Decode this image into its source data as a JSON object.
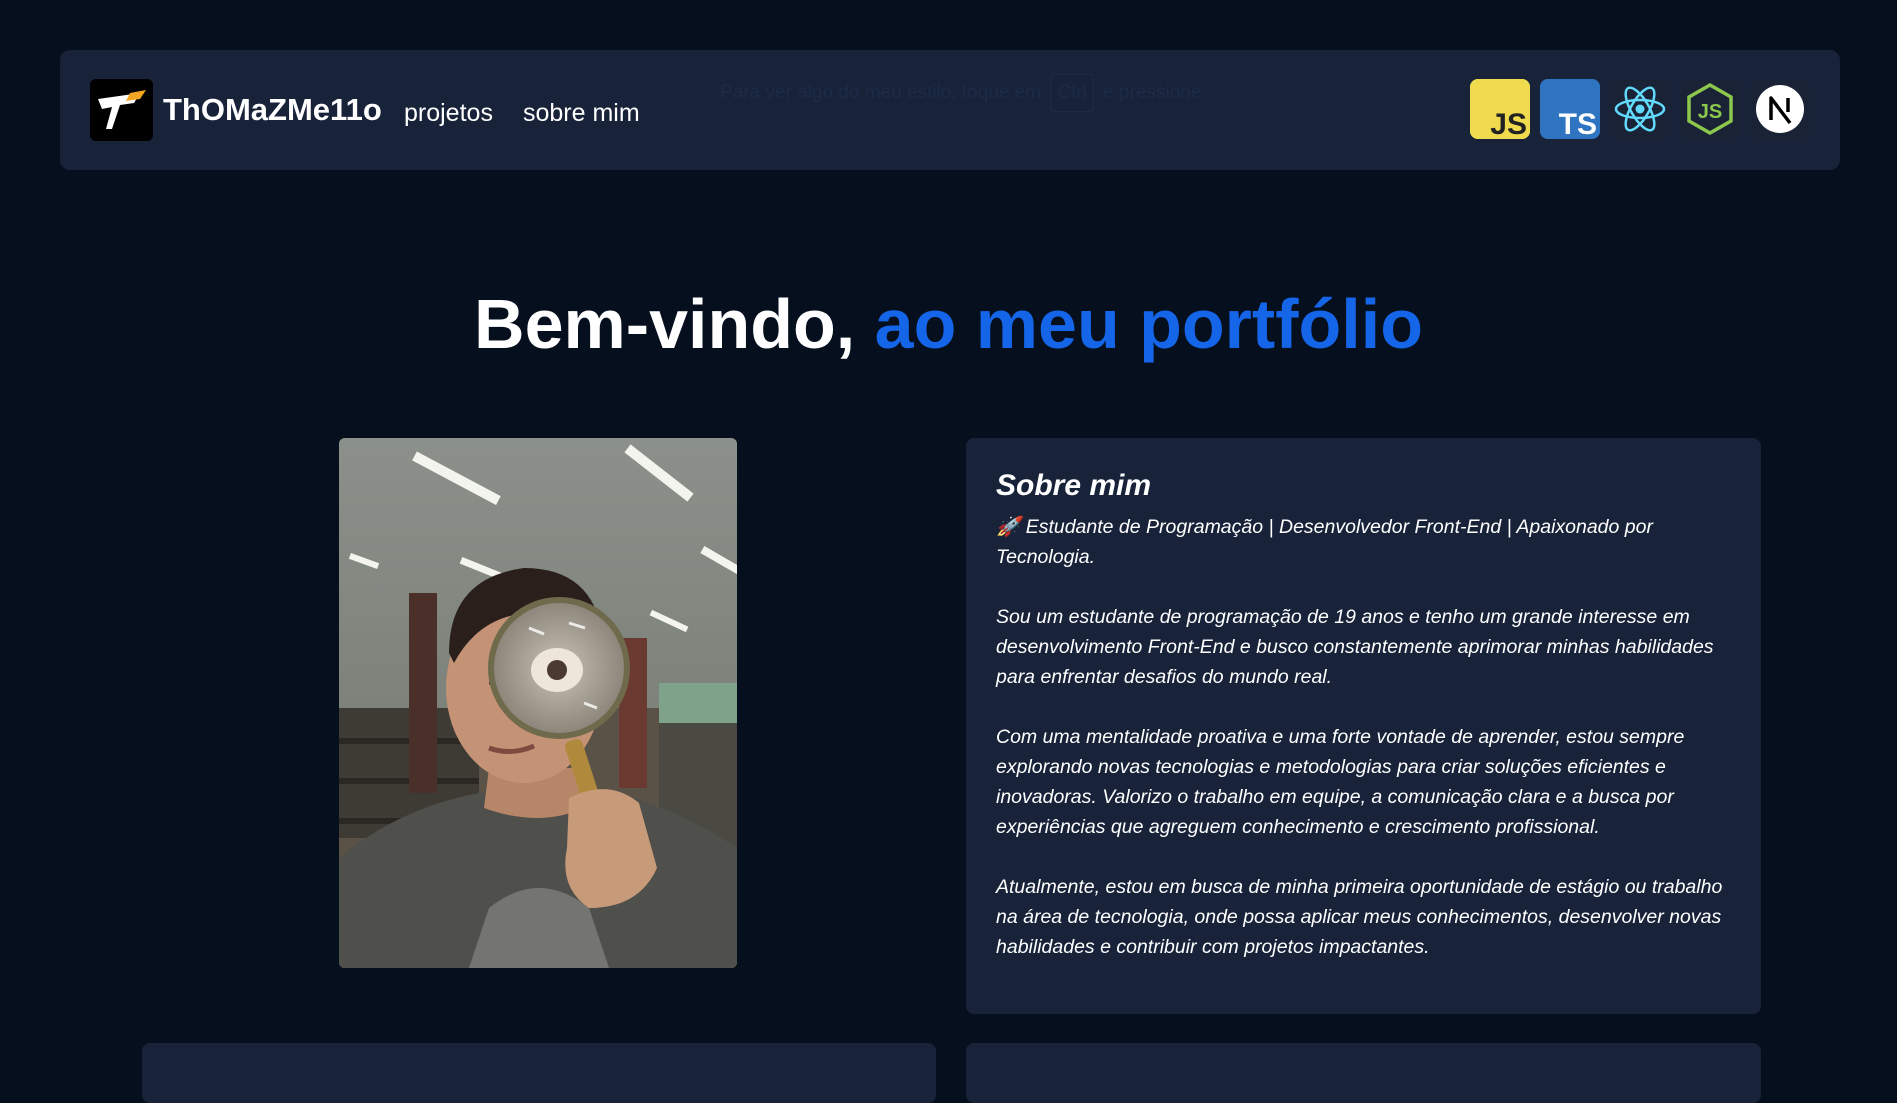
{
  "navbar": {
    "brand": "ThOMaZMe11o",
    "links": [
      "projetos",
      "sobre mim"
    ],
    "hint": {
      "before": "Para ver algo do meu estilo, toque em",
      "key": "Ctrl",
      "after": "e pressione"
    },
    "tech_icons": [
      {
        "name": "javascript-icon",
        "label": "JS",
        "color": "#f0db4f"
      },
      {
        "name": "typescript-icon",
        "label": "TS",
        "color": "#2f74c0"
      },
      {
        "name": "react-icon",
        "label": "",
        "color": "#61dafb"
      },
      {
        "name": "nodejs-icon",
        "label": "JS",
        "color": "#8cc84b"
      },
      {
        "name": "nextjs-icon",
        "label": "N",
        "color": "#ffffff"
      }
    ]
  },
  "hero": {
    "title_prefix": "Bem-vindo,",
    "title_accent": "ao meu portfólio",
    "accent_color": "#1565e9"
  },
  "about": {
    "title": "Sobre mim",
    "paragraphs": [
      "🚀 Estudante de Programação | Desenvolvedor Front-End | Apaixonado por Tecnologia.",
      "Sou um estudante de programação de 19 anos e tenho um grande interesse em desenvolvimento Front-End e busco constantemente aprimorar minhas habilidades para enfrentar desafios do mundo real.",
      "Com uma mentalidade proativa e uma forte vontade de aprender, estou sempre explorando novas tecnologias e metodologias para criar soluções eficientes e inovadoras. Valorizo o trabalho em equipe, a comunicação clara e a busca por experiências que agreguem conhecimento e crescimento profissional.",
      "Atualmente, estou em busca de minha primeira oportunidade de estágio ou trabalho na área de tecnologia, onde possa aplicar meus conhecimentos, desenvolver novas habilidades e contribuir com projetos impactantes."
    ]
  },
  "colors": {
    "background": "#050f1d",
    "card": "#18233a"
  }
}
